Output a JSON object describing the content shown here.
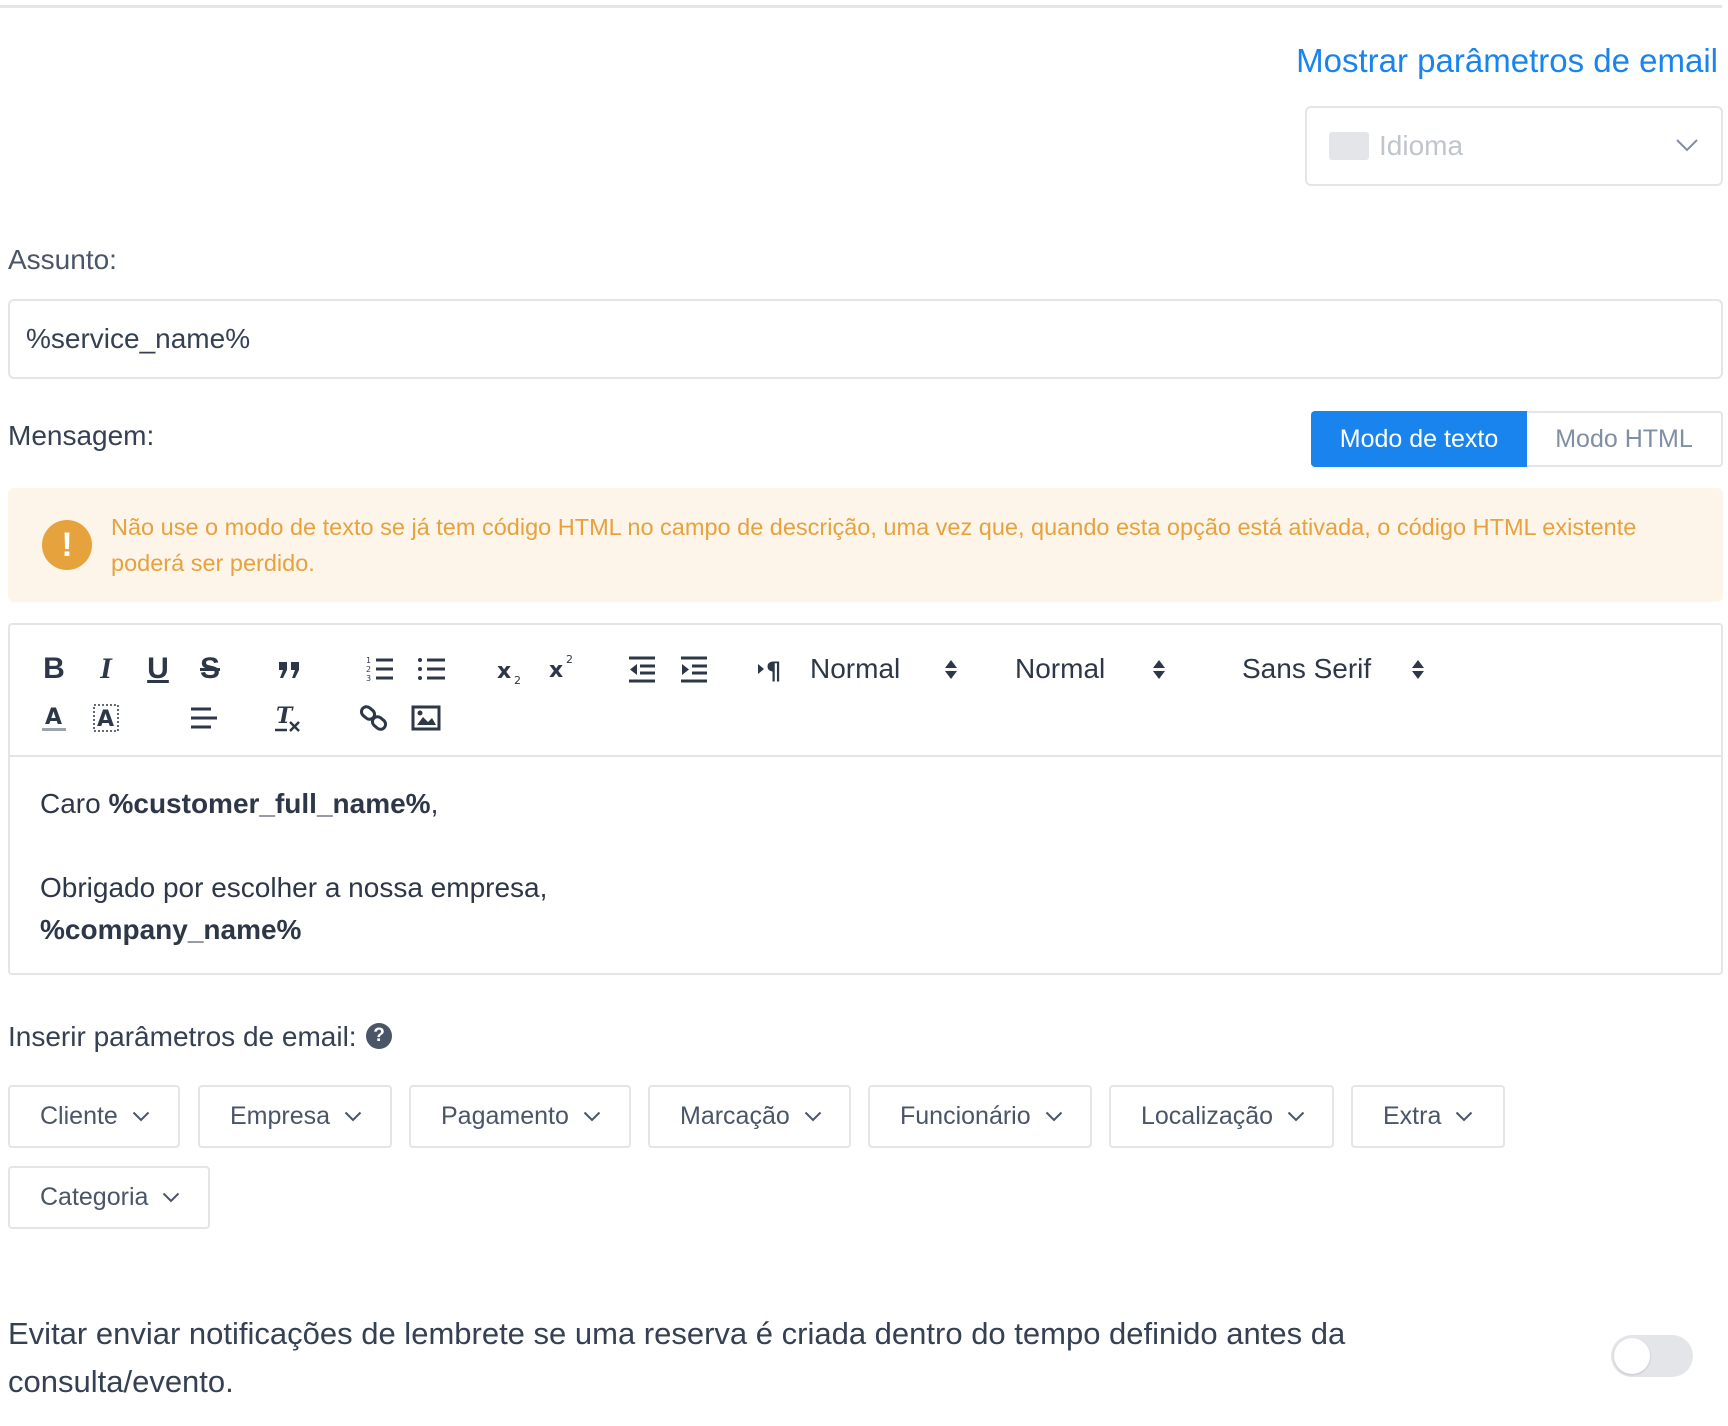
{
  "header": {
    "show_params_link": "Mostrar parâmetros de email"
  },
  "language_select": {
    "placeholder": "Idioma"
  },
  "subject": {
    "label": "Assunto:",
    "value": "%service_name%"
  },
  "message": {
    "label": "Mensagem:",
    "modes": {
      "text": "Modo de texto",
      "html": "Modo HTML",
      "active": "text"
    },
    "warning": "Não use o modo de texto se já tem código HTML no campo de descrição, uma vez que, quando esta opção está ativada, o código HTML existente poderá ser perdido.",
    "toolbar": {
      "header_picker": "Normal",
      "size_picker": "Normal",
      "font_picker": "Sans Serif"
    },
    "body": {
      "greeting": "Caro ",
      "customer_param": "%customer_full_name%",
      "greeting_end": ",",
      "thanks": "Obrigado por escolher a nossa empresa,",
      "company_param": "%company_name%"
    }
  },
  "insert_params": {
    "label": "Inserir parâmetros de email:",
    "help_icon": "?",
    "groups": [
      "Cliente",
      "Empresa",
      "Pagamento",
      "Marcação",
      "Funcionário",
      "Localização",
      "Extra",
      "Categoria"
    ]
  },
  "reminder": {
    "text": "Evitar enviar notificações de lembrete se uma reserva é criada dentro do tempo definido antes da consulta/evento.",
    "enabled": false
  },
  "colors": {
    "accent": "#1a84ee",
    "warning": "#e6a23c",
    "warning_bg": "#fdf4ea",
    "border": "#e3e5e9"
  }
}
